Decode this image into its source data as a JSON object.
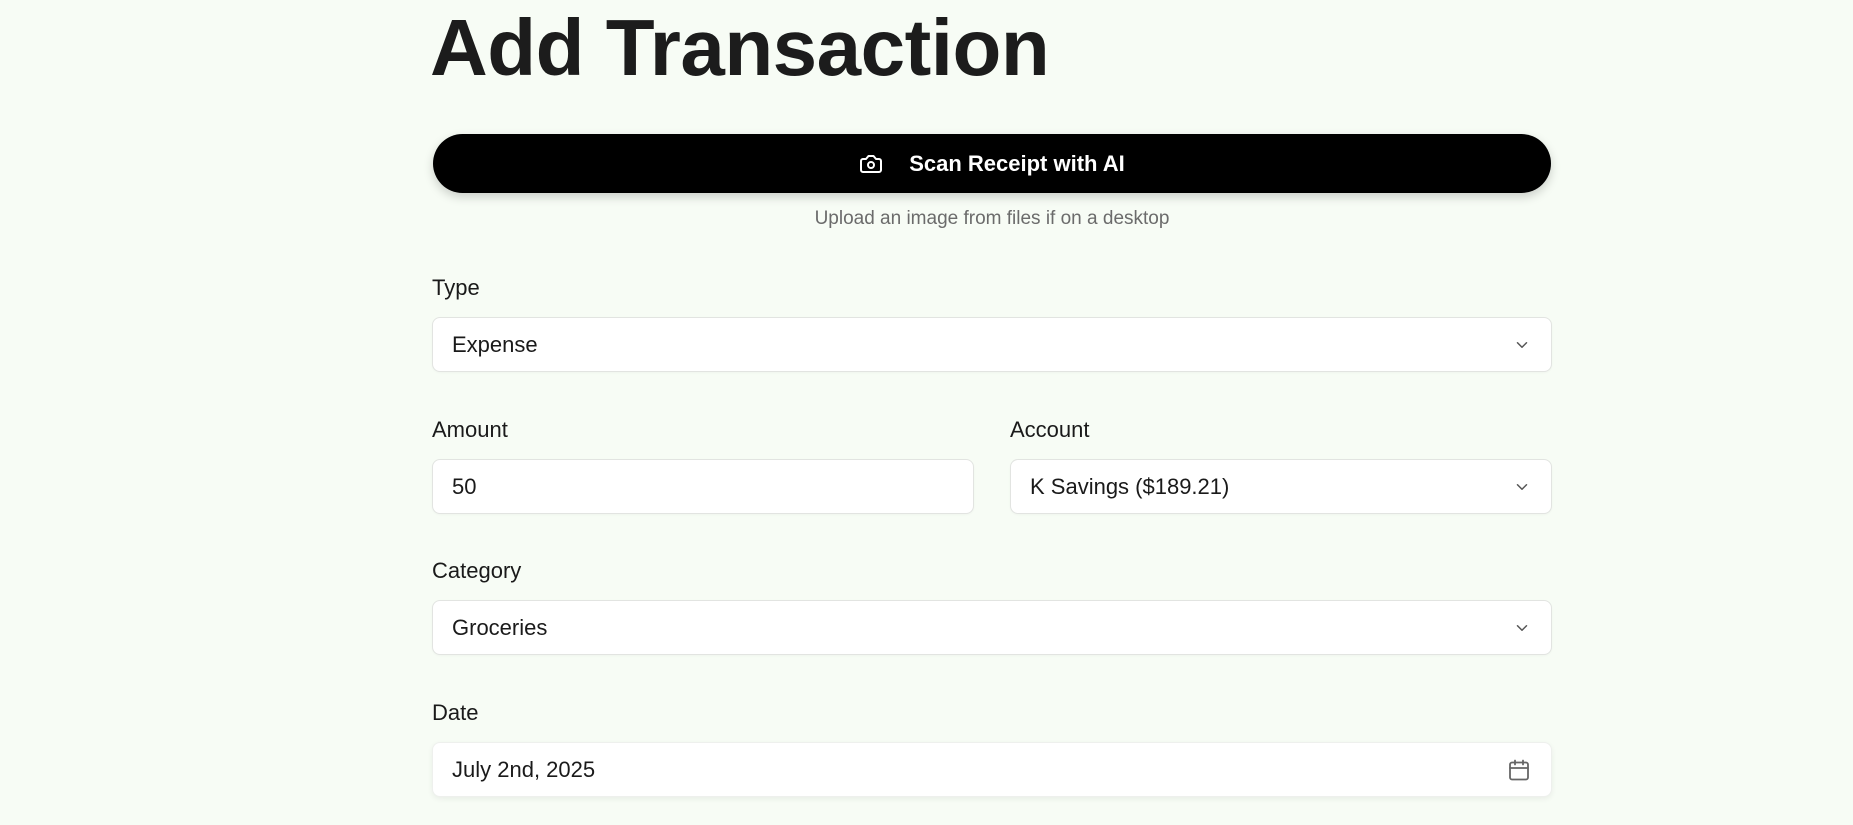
{
  "page": {
    "title": "Add Transaction"
  },
  "scan": {
    "button_label": "Scan Receipt with AI",
    "icon": "camera-icon",
    "hint": "Upload an image from files if on a desktop"
  },
  "form": {
    "type": {
      "label": "Type",
      "value": "Expense",
      "icon": "chevron-down-icon"
    },
    "amount": {
      "label": "Amount",
      "value": "50"
    },
    "account": {
      "label": "Account",
      "value": "K Savings ($189.21)",
      "icon": "chevron-down-icon"
    },
    "category": {
      "label": "Category",
      "value": "Groceries",
      "icon": "chevron-down-icon"
    },
    "date": {
      "label": "Date",
      "value": "July 2nd, 2025",
      "icon": "calendar-icon"
    }
  },
  "colors": {
    "background": "#f7fcf5",
    "primary_button": "#000000",
    "text": "#1a1a1a",
    "muted_text": "#6b6b6b"
  }
}
